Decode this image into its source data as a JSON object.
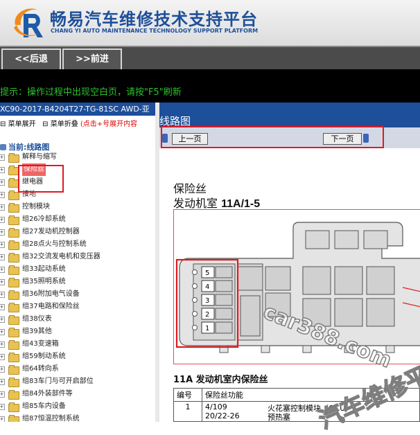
{
  "header": {
    "title": "畅易汽车维修技术支持平台",
    "subtitle": "CHANG YI AUTO MAINTENANCE TECHNOLOGY SUPPORT PLATFORM"
  },
  "nav": {
    "back": "<<后退",
    "forward": ">>前进"
  },
  "notice": "提示：操作过程中出现空白页，请按\"F5\"刷新",
  "sidebar": {
    "model": "XC90-2017-B4204T27-TG-81SC AWD-亚",
    "expand": "菜单展开",
    "collapse": "菜单折叠",
    "hint": "(点击+号展开内容",
    "root": "当前:线路图",
    "items": [
      {
        "label": "解释与缩写"
      },
      {
        "label": "保险丝"
      },
      {
        "label": "继电器"
      },
      {
        "label": "接地"
      },
      {
        "label": "控制模块"
      },
      {
        "label": "组26冷却系统"
      },
      {
        "label": "组27发动机控制器"
      },
      {
        "label": "组28点火与控制系统"
      },
      {
        "label": "组32交流发电机和变压器"
      },
      {
        "label": "组33起动系统"
      },
      {
        "label": "组35照明系统"
      },
      {
        "label": "组36附加电气设备"
      },
      {
        "label": "组37电路和保险丝"
      },
      {
        "label": "组38仪表"
      },
      {
        "label": "组39其他"
      },
      {
        "label": "组43变速箱"
      },
      {
        "label": "组59制动系统"
      },
      {
        "label": "组64转向系"
      },
      {
        "label": "组83车门与可开启部位"
      },
      {
        "label": "组84外装部件等"
      },
      {
        "label": "组85车内设备"
      },
      {
        "label": "组87恒温控制系统"
      }
    ]
  },
  "content": {
    "title": "线路图",
    "prev": "上一页",
    "next": "下一页",
    "heading": "保险丝",
    "subheading_prefix": "发动机室",
    "subheading_code": "11A/1-5",
    "table_title": "11A 发动机室内保险丝",
    "col_num": "编号",
    "col_func": "保险丝功能",
    "row_num": "1",
    "row_fuse_a": "4/109",
    "row_fuse_b": "20/22-26",
    "row_func_a": "火花塞控制模块（GCU）",
    "row_func_b": "预热塞"
  },
  "diagram": {
    "slot_labels": [
      "5",
      "4",
      "3",
      "2",
      "1"
    ]
  },
  "watermark": {
    "site": "car388.com",
    "slogan": "汽车维修平台"
  }
}
